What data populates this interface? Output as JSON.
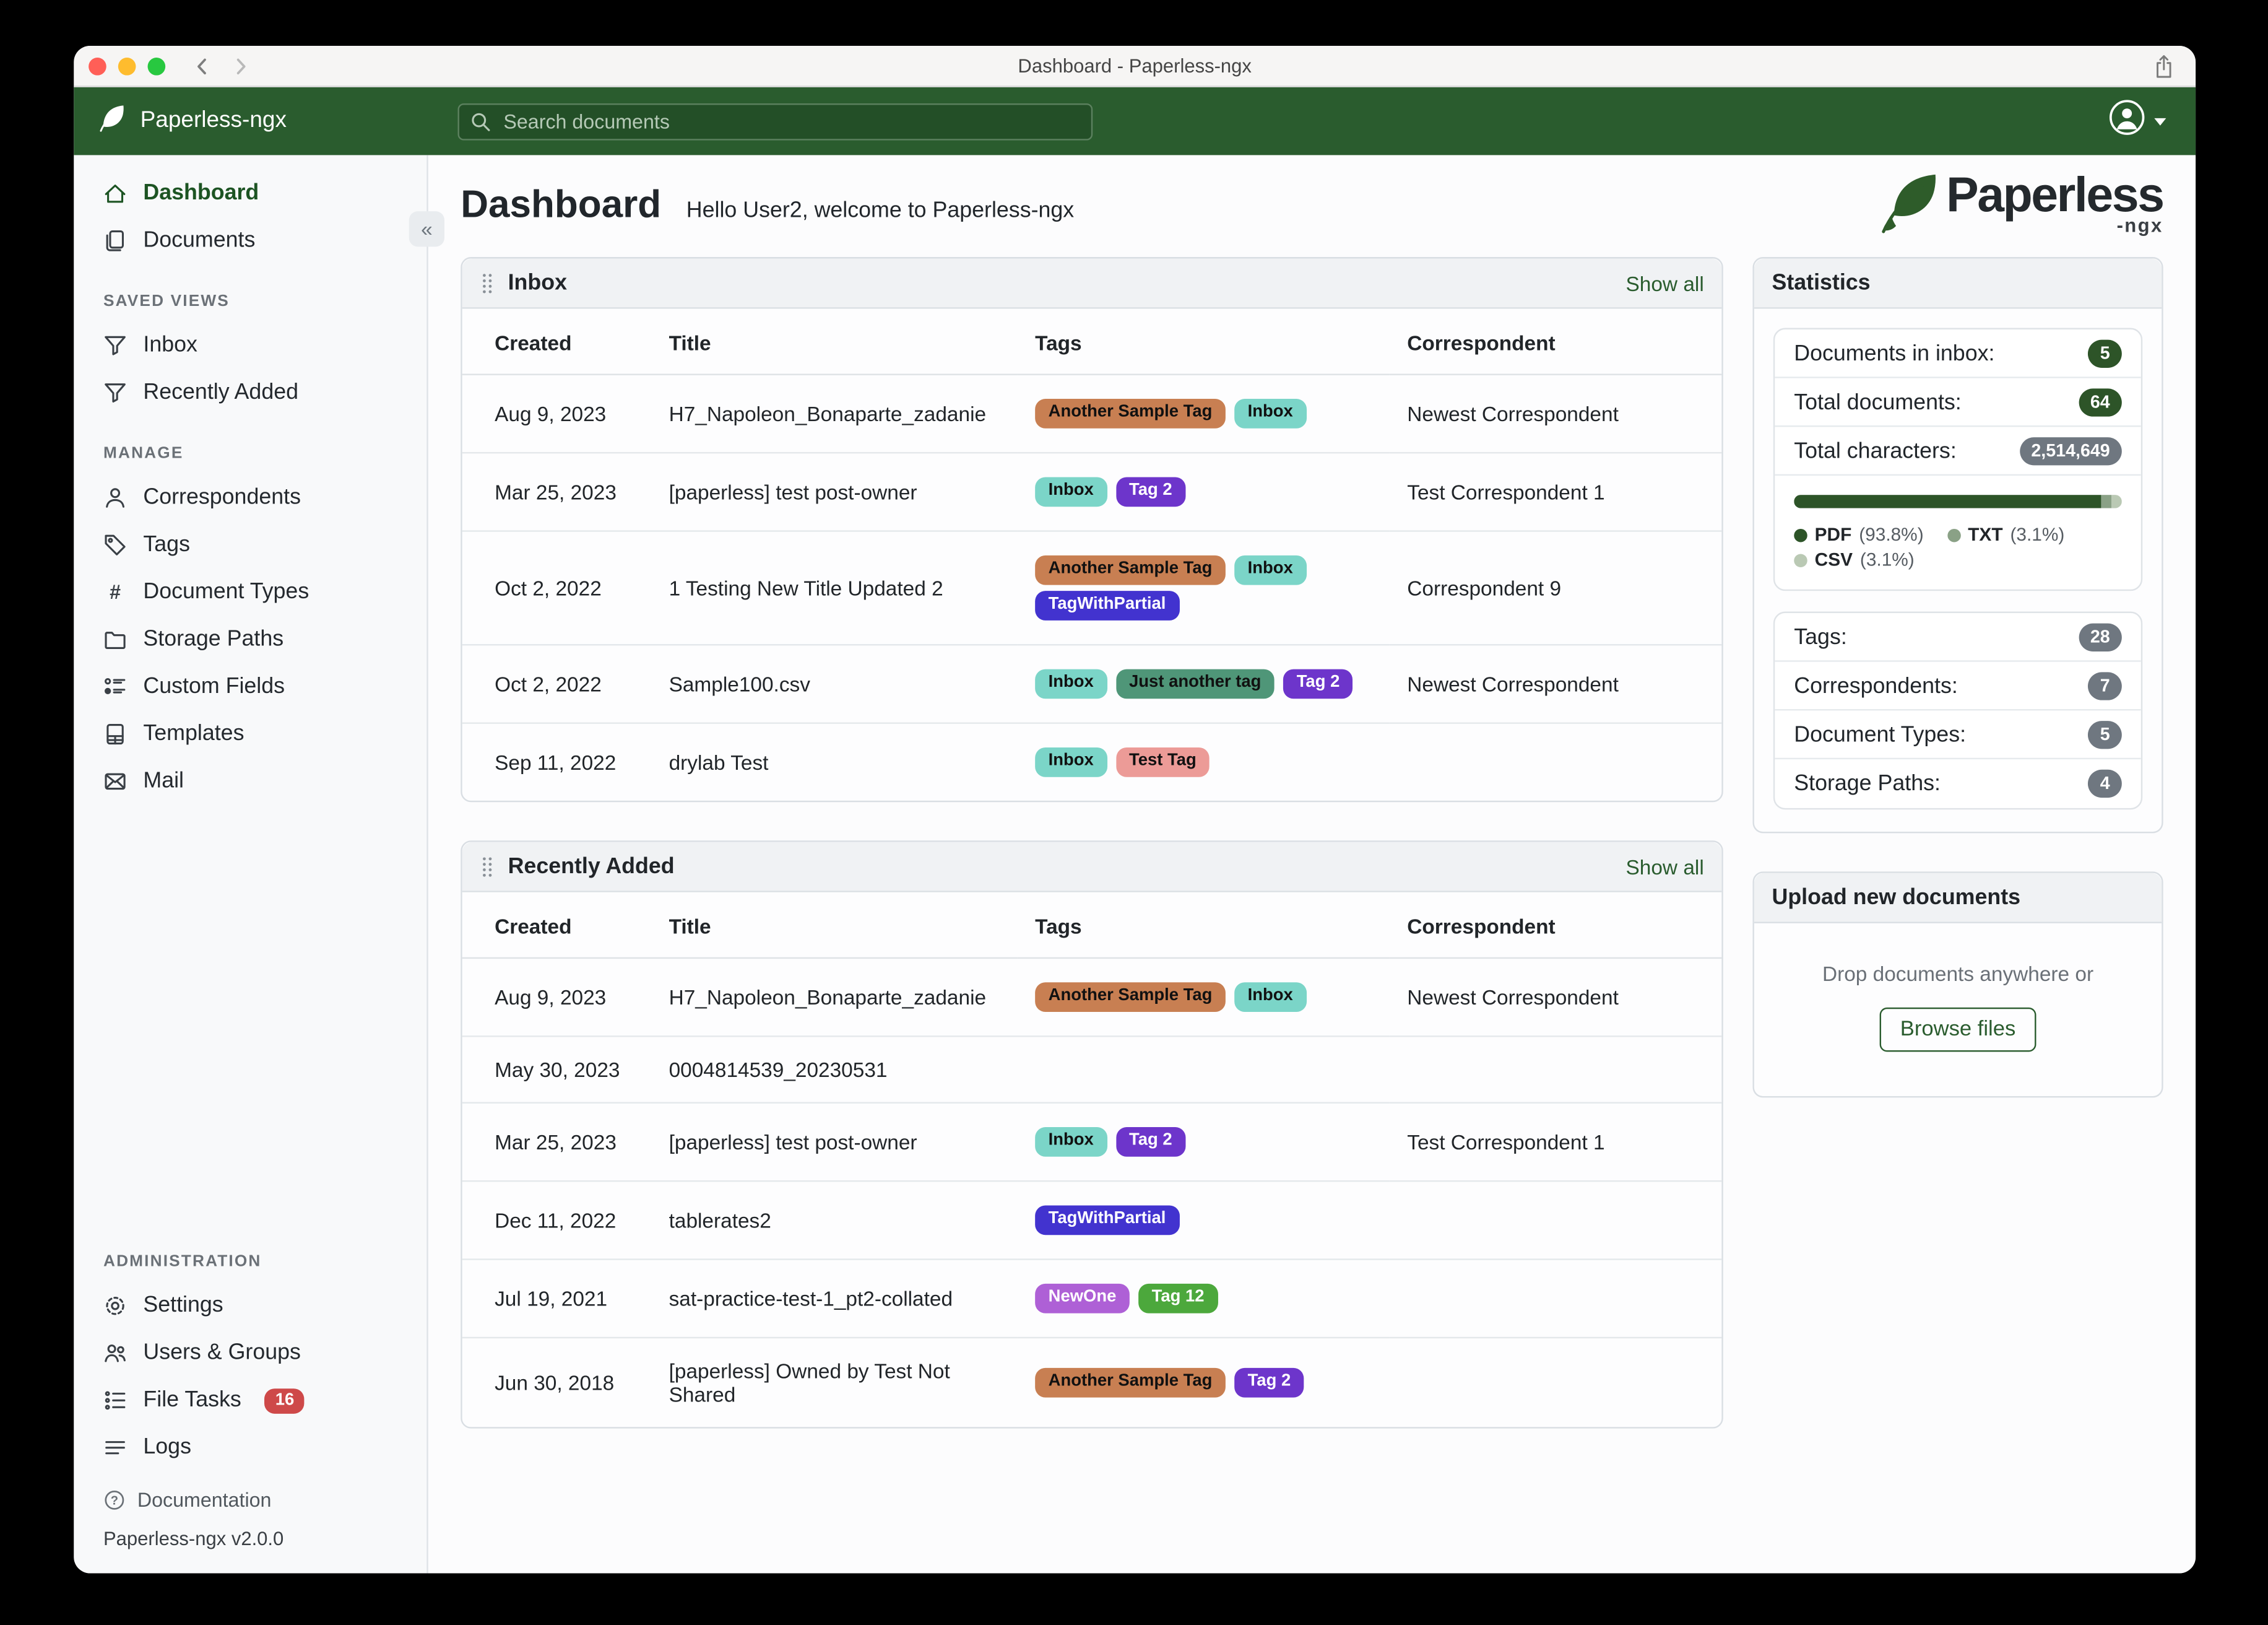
{
  "window": {
    "title": "Dashboard - Paperless-ngx"
  },
  "header": {
    "brand": "Paperless-ngx",
    "search_placeholder": "Search documents"
  },
  "colors": {
    "header_green": "#2a5c2e",
    "accent_green": "#2a5c2e",
    "badge_green": "#2d5428",
    "badge_gray": "#6f7780",
    "file_tasks_badge": "#ce4949"
  },
  "sidebar": {
    "primary": [
      {
        "label": "Dashboard",
        "icon": "home",
        "active": true
      },
      {
        "label": "Documents",
        "icon": "files",
        "active": false
      }
    ],
    "sections": [
      {
        "title": "SAVED VIEWS",
        "push": false,
        "items": [
          {
            "label": "Inbox",
            "icon": "funnel"
          },
          {
            "label": "Recently Added",
            "icon": "funnel"
          }
        ]
      },
      {
        "title": "MANAGE",
        "push": false,
        "items": [
          {
            "label": "Correspondents",
            "icon": "person"
          },
          {
            "label": "Tags",
            "icon": "tag"
          },
          {
            "label": "Document Types",
            "icon": "hash"
          },
          {
            "label": "Storage Paths",
            "icon": "folder"
          },
          {
            "label": "Custom Fields",
            "icon": "fields"
          },
          {
            "label": "Templates",
            "icon": "template"
          },
          {
            "label": "Mail",
            "icon": "mail"
          }
        ]
      },
      {
        "title": "ADMINISTRATION",
        "push": true,
        "items": [
          {
            "label": "Settings",
            "icon": "gear"
          },
          {
            "label": "Users & Groups",
            "icon": "people"
          },
          {
            "label": "File Tasks",
            "icon": "tasks",
            "badge": "16"
          },
          {
            "label": "Logs",
            "icon": "logs"
          }
        ]
      }
    ],
    "documentation": "Documentation",
    "version": "Paperless-ngx v2.0.0"
  },
  "page": {
    "title": "Dashboard",
    "subtitle": "Hello User2, welcome to Paperless-ngx"
  },
  "logo": {
    "text": "Paperless",
    "suffix": "-ngx"
  },
  "tag_colors": {
    "Another Sample Tag": {
      "bg": "#c87f52",
      "fg": "#111111"
    },
    "Inbox": {
      "bg": "#7bd5c8",
      "fg": "#111111"
    },
    "Tag 2": {
      "bg": "#6d35cb",
      "fg": "#ffffff"
    },
    "TagWithPartial": {
      "bg": "#4233cf",
      "fg": "#ffffff"
    },
    "Just another tag": {
      "bg": "#4f9678",
      "fg": "#111111"
    },
    "Test Tag": {
      "bg": "#ec9b97",
      "fg": "#111111"
    },
    "NewOne": {
      "bg": "#ae60d6",
      "fg": "#ffffff"
    },
    "Tag 12": {
      "bg": "#4ca83c",
      "fg": "#ffffff"
    }
  },
  "widgets": [
    {
      "title": "Inbox",
      "show_all": "Show all",
      "columns": [
        "Created",
        "Title",
        "Tags",
        "Correspondent"
      ],
      "rows": [
        {
          "created": "Aug 9, 2023",
          "title": "H7_Napoleon_Bonaparte_zadanie",
          "tags": [
            "Another Sample Tag",
            "Inbox"
          ],
          "correspondent": "Newest Correspondent"
        },
        {
          "created": "Mar 25, 2023",
          "title": "[paperless] test post-owner",
          "tags": [
            "Inbox",
            "Tag 2"
          ],
          "correspondent": "Test Correspondent 1"
        },
        {
          "created": "Oct 2, 2022",
          "title": "1 Testing New Title Updated 2",
          "tags": [
            "Another Sample Tag",
            "Inbox",
            "TagWithPartial"
          ],
          "correspondent": "Correspondent 9"
        },
        {
          "created": "Oct 2, 2022",
          "title": "Sample100.csv",
          "tags": [
            "Inbox",
            "Just another tag",
            "Tag 2"
          ],
          "correspondent": "Newest Correspondent"
        },
        {
          "created": "Sep 11, 2022",
          "title": "drylab Test",
          "tags": [
            "Inbox",
            "Test Tag"
          ],
          "correspondent": ""
        }
      ]
    },
    {
      "title": "Recently Added",
      "show_all": "Show all",
      "columns": [
        "Created",
        "Title",
        "Tags",
        "Correspondent"
      ],
      "rows": [
        {
          "created": "Aug 9, 2023",
          "title": "H7_Napoleon_Bonaparte_zadanie",
          "tags": [
            "Another Sample Tag",
            "Inbox"
          ],
          "correspondent": "Newest Correspondent"
        },
        {
          "created": "May 30, 2023",
          "title": "0004814539_20230531",
          "tags": [],
          "correspondent": ""
        },
        {
          "created": "Mar 25, 2023",
          "title": "[paperless] test post-owner",
          "tags": [
            "Inbox",
            "Tag 2"
          ],
          "correspondent": "Test Correspondent 1"
        },
        {
          "created": "Dec 11, 2022",
          "title": "tablerates2",
          "tags": [
            "TagWithPartial"
          ],
          "correspondent": ""
        },
        {
          "created": "Jul 19, 2021",
          "title": "sat-practice-test-1_pt2-collated",
          "tags": [
            "NewOne",
            "Tag 12"
          ],
          "correspondent": ""
        },
        {
          "created": "Jun 30, 2018",
          "title": "[paperless] Owned by Test Not Shared",
          "tags": [
            "Another Sample Tag",
            "Tag 2"
          ],
          "correspondent": ""
        }
      ]
    }
  ],
  "statistics": {
    "title": "Statistics",
    "rows": [
      {
        "label": "Documents in inbox:",
        "value": "5",
        "style": "green"
      },
      {
        "label": "Total documents:",
        "value": "64",
        "style": "green"
      },
      {
        "label": "Total characters:",
        "value": "2,514,649",
        "style": "gray"
      }
    ],
    "file_types": [
      {
        "name": "PDF",
        "pct": "93.8%",
        "color": "#2d5428"
      },
      {
        "name": "TXT",
        "pct": "3.1%",
        "color": "#8aa186"
      },
      {
        "name": "CSV",
        "pct": "3.1%",
        "color": "#bac9b4"
      }
    ],
    "counts": [
      {
        "label": "Tags:",
        "value": "28"
      },
      {
        "label": "Correspondents:",
        "value": "7"
      },
      {
        "label": "Document Types:",
        "value": "5"
      },
      {
        "label": "Storage Paths:",
        "value": "4"
      }
    ]
  },
  "upload": {
    "title": "Upload new documents",
    "hint": "Drop documents anywhere or",
    "button": "Browse files"
  }
}
